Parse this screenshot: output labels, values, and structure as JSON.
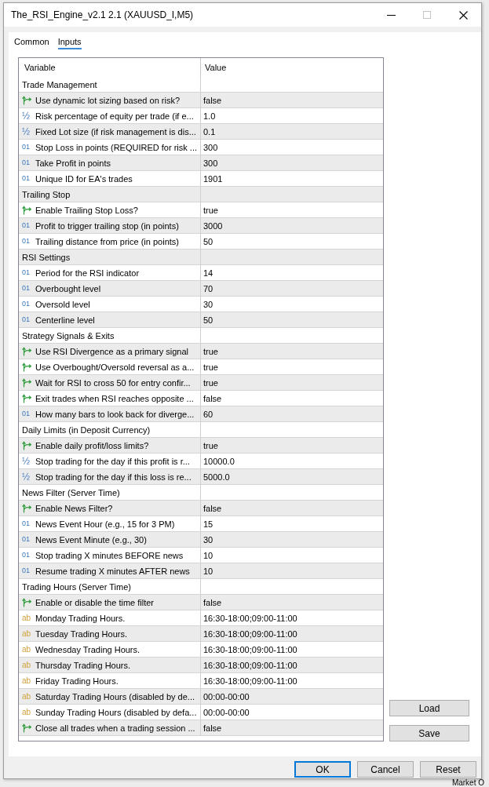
{
  "window": {
    "title": "The_RSI_Engine_v2.1 2.1 (XAUUSD_I,M5)",
    "maximize_enabled": false
  },
  "tabs": [
    {
      "label": "Common",
      "selected": false
    },
    {
      "label": "Inputs",
      "selected": true
    }
  ],
  "table": {
    "columns": [
      "Variable",
      "Value"
    ],
    "rows": [
      {
        "kind": "group",
        "variable": "Trade Management"
      },
      {
        "kind": "bool",
        "variable": "Use dynamic lot sizing based on risk?",
        "value": "false"
      },
      {
        "kind": "double",
        "type_label": "½",
        "variable": "Risk percentage of equity per trade (if e...",
        "value": "1.0"
      },
      {
        "kind": "double",
        "type_label": "½",
        "variable": "Fixed Lot size (if risk management is dis...",
        "value": "0.1"
      },
      {
        "kind": "int",
        "type_label": "01",
        "variable": "Stop Loss in points (REQUIRED for risk ...",
        "value": "300"
      },
      {
        "kind": "int",
        "type_label": "01",
        "variable": "Take Profit in points",
        "value": "300"
      },
      {
        "kind": "int",
        "type_label": "01",
        "variable": "Unique ID for EA's trades",
        "value": "1901"
      },
      {
        "kind": "group",
        "variable": "Trailing Stop"
      },
      {
        "kind": "bool",
        "variable": "Enable Trailing Stop Loss?",
        "value": "true"
      },
      {
        "kind": "int",
        "type_label": "01",
        "variable": "Profit to trigger trailing stop (in points)",
        "value": "3000"
      },
      {
        "kind": "int",
        "type_label": "01",
        "variable": "Trailing distance from price (in points)",
        "value": "50"
      },
      {
        "kind": "group",
        "variable": "RSI Settings"
      },
      {
        "kind": "int",
        "type_label": "01",
        "variable": "Period for the RSI indicator",
        "value": "14"
      },
      {
        "kind": "int",
        "type_label": "01",
        "variable": "Overbought level",
        "value": "70"
      },
      {
        "kind": "int",
        "type_label": "01",
        "variable": "Oversold level",
        "value": "30"
      },
      {
        "kind": "int",
        "type_label": "01",
        "variable": "Centerline level",
        "value": "50"
      },
      {
        "kind": "group",
        "variable": "Strategy Signals & Exits"
      },
      {
        "kind": "bool",
        "variable": "Use RSI Divergence as a primary signal",
        "value": "true"
      },
      {
        "kind": "bool",
        "variable": "Use Overbought/Oversold reversal as a...",
        "value": "true"
      },
      {
        "kind": "bool",
        "variable": "Wait for RSI to cross 50 for entry confir...",
        "value": "true"
      },
      {
        "kind": "bool",
        "variable": "Exit trades when RSI reaches opposite ...",
        "value": "false"
      },
      {
        "kind": "int",
        "type_label": "01",
        "variable": "How many bars to look back for diverge...",
        "value": "60"
      },
      {
        "kind": "group",
        "variable": "Daily Limits (in Deposit Currency)"
      },
      {
        "kind": "bool",
        "variable": "Enable daily profit/loss limits?",
        "value": "true"
      },
      {
        "kind": "double",
        "type_label": "½",
        "variable": "Stop trading for the day if this profit is r...",
        "value": "10000.0"
      },
      {
        "kind": "double",
        "type_label": "½",
        "variable": "Stop trading for the day if this loss is re...",
        "value": "5000.0"
      },
      {
        "kind": "group",
        "variable": "News Filter (Server Time)"
      },
      {
        "kind": "bool",
        "variable": "Enable News Filter?",
        "value": "false"
      },
      {
        "kind": "int",
        "type_label": "01",
        "variable": "News Event Hour (e.g., 15 for 3 PM)",
        "value": "15"
      },
      {
        "kind": "int",
        "type_label": "01",
        "variable": "News Event Minute (e.g., 30)",
        "value": "30"
      },
      {
        "kind": "int",
        "type_label": "01",
        "variable": "Stop trading X minutes BEFORE news",
        "value": "10"
      },
      {
        "kind": "int",
        "type_label": "01",
        "variable": "Resume trading X minutes AFTER news",
        "value": "10"
      },
      {
        "kind": "group",
        "variable": "Trading Hours (Server Time)"
      },
      {
        "kind": "bool",
        "variable": "Enable or disable the time filter",
        "value": "false"
      },
      {
        "kind": "string",
        "type_label": "ab",
        "variable": "Monday Trading Hours.",
        "value": "16:30-18:00;09:00-11:00"
      },
      {
        "kind": "string",
        "type_label": "ab",
        "variable": "Tuesday Trading Hours.",
        "value": "16:30-18:00;09:00-11:00"
      },
      {
        "kind": "string",
        "type_label": "ab",
        "variable": "Wednesday Trading Hours.",
        "value": "16:30-18:00;09:00-11:00"
      },
      {
        "kind": "string",
        "type_label": "ab",
        "variable": "Thursday Trading Hours.",
        "value": "16:30-18:00;09:00-11:00"
      },
      {
        "kind": "string",
        "type_label": "ab",
        "variable": "Friday Trading Hours.",
        "value": "16:30-18:00;09:00-11:00"
      },
      {
        "kind": "string",
        "type_label": "ab",
        "variable": "Saturday Trading Hours (disabled by de...",
        "value": "00:00-00:00"
      },
      {
        "kind": "string",
        "type_label": "ab",
        "variable": "Sunday Trading Hours (disabled by defa...",
        "value": "00:00-00:00"
      },
      {
        "kind": "bool",
        "variable": "Close all trades when a trading session ...",
        "value": "false"
      }
    ]
  },
  "side_buttons": [
    "Load",
    "Save"
  ],
  "buttons": [
    {
      "label": "OK",
      "default": true
    },
    {
      "label": "Cancel",
      "default": false
    },
    {
      "label": "Reset",
      "default": false
    }
  ],
  "background": {
    "label": "Market O"
  }
}
